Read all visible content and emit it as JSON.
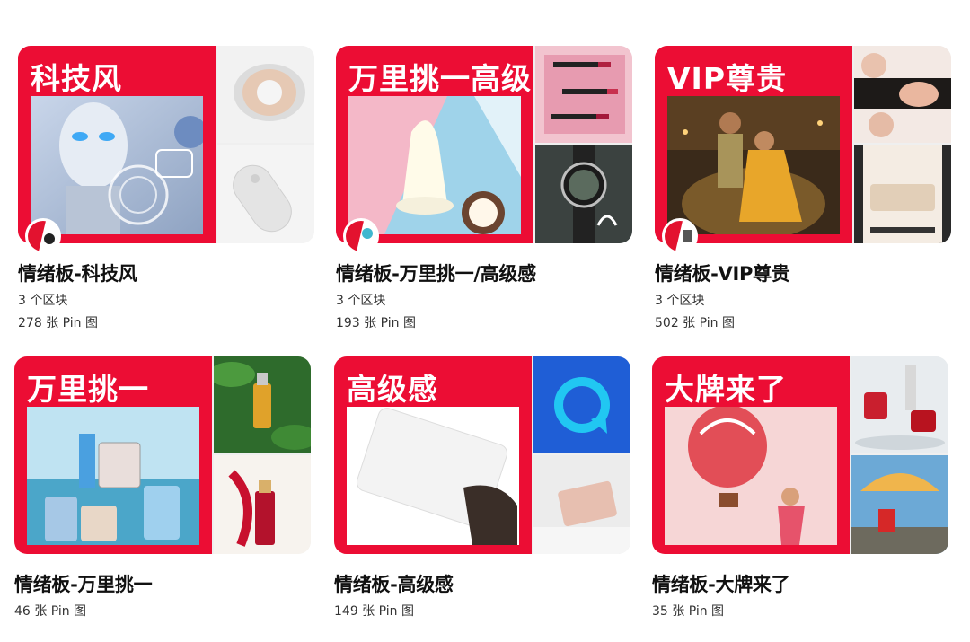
{
  "boards": [
    {
      "cover_title": "科技风",
      "title": "情绪板-科技风",
      "sections": "3 个区块",
      "pins": "278 张 Pin 图",
      "cover_image": "robot-face-image",
      "side_top_image": "speaker-product-image",
      "side_bottom_image": "remote-product-image",
      "has_avatar": true
    },
    {
      "cover_title": "万里挑一高级",
      "title": "情绪板-万里挑一/高级感",
      "sections": "3 个区块",
      "pins": "193 张 Pin 图",
      "cover_image": "milk-coconut-image",
      "side_top_image": "lipstick-image",
      "side_bottom_image": "watch-ad-image",
      "has_avatar": true
    },
    {
      "cover_title": "VIP尊贵",
      "title": "情绪板-VIP尊贵",
      "sections": "3 个区块",
      "pins": "502 张 Pin 图",
      "cover_image": "royal-couple-image",
      "side_top_image": "beauty-ad-image",
      "side_bottom_image": "app-screen-image",
      "has_avatar": true
    },
    {
      "cover_title": "万里挑一",
      "title": "情绪板-万里挑一",
      "pins": "46 张 Pin 图",
      "cover_image": "perfume-bottles-image",
      "side_top_image": "serum-leaves-image",
      "side_bottom_image": "red-serum-image",
      "has_avatar": false
    },
    {
      "cover_title": "高级感",
      "title": "情绪板-高级感",
      "pins": "149 张 Pin 图",
      "cover_image": "white-card-image",
      "side_top_image": "blue-q-logo-image",
      "side_bottom_image": "card-on-white-image",
      "has_avatar": false
    },
    {
      "cover_title": "大牌来了",
      "title": "情绪板-大牌来了",
      "pins": "35 张 Pin 图",
      "cover_image": "hot-air-balloon-image",
      "side_top_image": "cosmetics-splash-image",
      "side_bottom_image": "planes-sky-image",
      "has_avatar": false
    }
  ],
  "colors": {
    "brand_red": "#ec0d34",
    "text": "#111111"
  }
}
